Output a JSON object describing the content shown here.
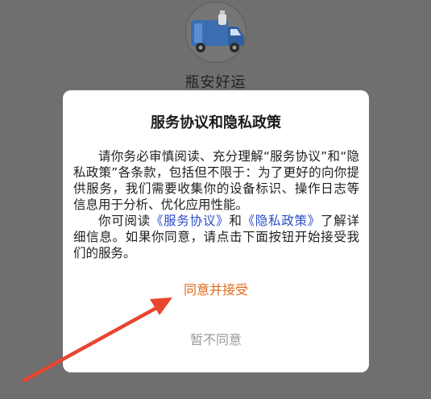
{
  "app": {
    "name": "瓶安好运",
    "logo_icon": "delivery-truck-icon"
  },
  "dialog": {
    "title": "服务协议和隐私政策",
    "paragraph1": "请你务必审慎阅读、充分理解“服务协议”和“隐私政策”各条款，包括但不限于：为了更好的向你提供服务，我们需要收集你的设备标识、操作日志等信息用于分析、优化应用性能。",
    "paragraph2_prefix": "你可阅读",
    "service_link": "《服务协议》",
    "and_text": "和",
    "privacy_link": "《隐私政策》",
    "paragraph2_suffix": "了解详细信息。如果你同意，请点击下面按钮开始接受我们的服务。",
    "agree_label": "同意并接受",
    "decline_label": "暂不同意"
  },
  "annotation": {
    "arrow_icon": "red-arrow-pointer-icon",
    "color": "#e8452f"
  },
  "colors": {
    "overlay": "#6f6f6f",
    "agree": "#e26a1b",
    "decline": "#999999",
    "link": "#2b4bc8"
  }
}
